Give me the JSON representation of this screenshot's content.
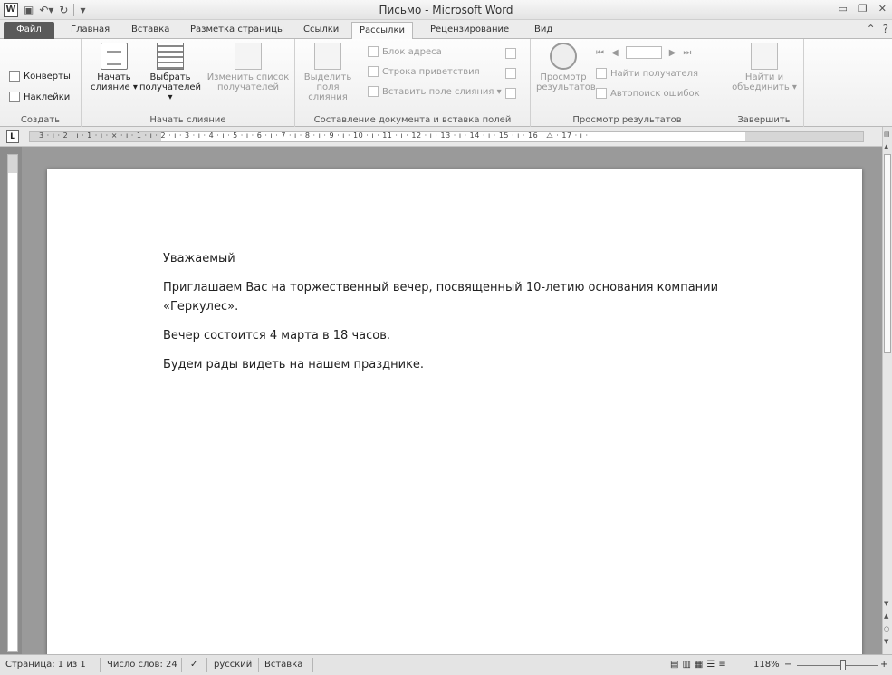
{
  "window": {
    "title": "Письмо - Microsoft Word",
    "app_icon_letter": "W"
  },
  "tabs": {
    "file": "Файл",
    "items": [
      "Главная",
      "Вставка",
      "Разметка страницы",
      "Ссылки",
      "Рассылки",
      "Рецензирование",
      "Вид"
    ],
    "active": "Рассылки"
  },
  "ribbon": {
    "create": {
      "label": "Создать",
      "envelopes": "Конверты",
      "labels": "Наклейки"
    },
    "start_merge": {
      "label": "Начать слияние",
      "start_line1": "Начать",
      "start_line2": "слияние ▾",
      "select_line1": "Выбрать",
      "select_line2": "получателей ▾",
      "edit_line1": "Изменить список",
      "edit_line2": "получателей"
    },
    "write_insert": {
      "label": "Составление документа и вставка полей",
      "highlight_line1": "Выделить",
      "highlight_line2": "поля слияния",
      "address_block": "Блок адреса",
      "greeting_line": "Строка приветствия",
      "insert_field": "Вставить поле слияния ▾"
    },
    "preview": {
      "label": "Просмотр результатов",
      "preview_line1": "Просмотр",
      "preview_line2": "результатов",
      "find_recipient": "Найти получателя",
      "auto_check": "Автопоиск ошибок"
    },
    "finish": {
      "label": "Завершить",
      "finish_line1": "Найти и",
      "finish_line2": "объединить ▾"
    }
  },
  "ruler": {
    "tab_button": "L",
    "numbers": "3 · ı · 2 · ı · 1 · ı · ⨯ · ı · 1 · ı · 2 · ı · 3 · ı · 4 · ı · 5 · ı · 6 · ı · 7 · ı · 8 · ı · 9 · ı · 10 · ı · 11 · ı · 12 · ı · 13 · ı · 14 · ı · 15 · ı · 16 · ⧍ · 17 · ı ·"
  },
  "document": {
    "p1": "Уважаемый",
    "p2": "Приглашаем Вас на торжественный вечер, посвященный 10-летию основания компании «Геркулес».",
    "p3": "Вечер состоится 4 марта в 18 часов.",
    "p4": "Будем рады видеть на нашем празднике."
  },
  "statusbar": {
    "page": "Страница: 1 из 1",
    "words": "Число слов: 24",
    "language": "русский",
    "mode": "Вставка",
    "zoom": "118%",
    "zoom_minus": "−",
    "zoom_plus": "+"
  }
}
